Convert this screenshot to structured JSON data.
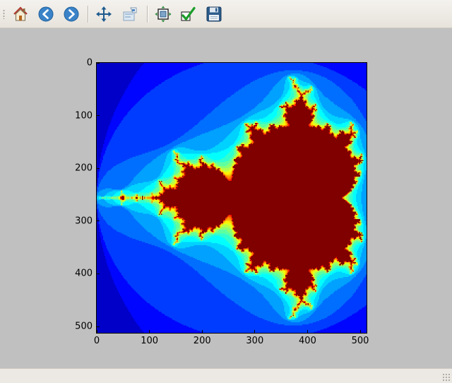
{
  "toolbar": {
    "buttons": [
      {
        "name": "home-button",
        "icon": "home-icon",
        "tooltip": ""
      },
      {
        "name": "back-button",
        "icon": "back-arrow-icon",
        "tooltip": ""
      },
      {
        "name": "forward-button",
        "icon": "forward-arrow-icon",
        "tooltip": ""
      },
      {
        "name": "pan-button",
        "icon": "pan-arrows-icon",
        "tooltip": ""
      },
      {
        "name": "zoom-button",
        "icon": "zoom-rect-icon",
        "tooltip": ""
      },
      {
        "name": "subplots-button",
        "icon": "subplots-config-icon",
        "tooltip": ""
      },
      {
        "name": "edit-axis-button",
        "icon": "checkmark-icon",
        "tooltip": ""
      },
      {
        "name": "save-button",
        "icon": "floppy-disk-icon",
        "tooltip": ""
      }
    ]
  },
  "colors": {
    "background": "#c0c0c0",
    "outer_field": "#000080",
    "set_interior": "#7f0000",
    "colormap": "jet"
  },
  "chart_data": {
    "type": "heatmap",
    "title": "",
    "xlabel": "",
    "ylabel": "",
    "image_size": [
      512,
      512
    ],
    "xlim": [
      0,
      512
    ],
    "ylim": [
      512,
      0
    ],
    "x_ticks": [
      "0",
      "100",
      "200",
      "300",
      "400",
      "500"
    ],
    "y_ticks": [
      "0",
      "100",
      "200",
      "300",
      "400",
      "500"
    ],
    "x_tick_values": [
      0,
      100,
      200,
      300,
      400,
      500
    ],
    "y_tick_values": [
      0,
      100,
      200,
      300,
      400,
      500
    ],
    "colormap": "jet",
    "content": "Mandelbrot set escape-time image",
    "complex_range": {
      "re": [
        -2.0,
        0.5
      ],
      "im": [
        -1.25,
        1.25
      ]
    },
    "max_iterations": 20,
    "grid": false,
    "legend": "none"
  }
}
